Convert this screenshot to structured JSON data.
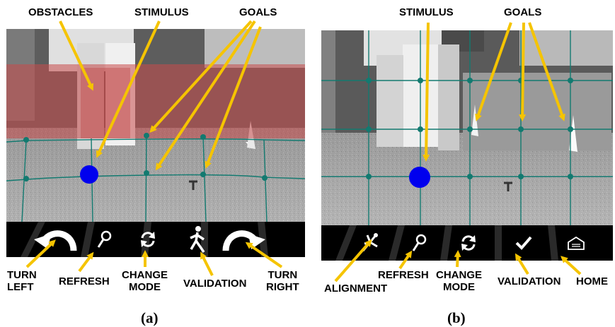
{
  "panel_a": {
    "caption": "(a)",
    "top_labels": {
      "obstacles": "OBSTACLES",
      "stimulus": "STIMULUS",
      "goals": "GOALS"
    },
    "toolbar": [
      {
        "icon": "turn-left-icon",
        "label": "TURN LEFT",
        "line1": "TURN",
        "line2": "LEFT"
      },
      {
        "icon": "refresh-icon",
        "label": "REFRESH"
      },
      {
        "icon": "change-mode-icon",
        "label": "CHANGE MODE",
        "line1": "CHANGE",
        "line2": "MODE"
      },
      {
        "icon": "validation-icon",
        "label": "VALIDATION"
      },
      {
        "icon": "turn-right-icon",
        "label": "TURN RIGHT",
        "line1": "TURN",
        "line2": "RIGHT"
      }
    ]
  },
  "panel_b": {
    "caption": "(b)",
    "top_labels": {
      "stimulus": "STIMULUS",
      "goals": "GOALS"
    },
    "toolbar": [
      {
        "icon": "alignment-icon",
        "label": "ALIGNMENT"
      },
      {
        "icon": "refresh-icon",
        "label": "REFRESH"
      },
      {
        "icon": "change-mode-icon",
        "label": "CHANGE MODE",
        "line1": "CHANGE",
        "line2": "MODE"
      },
      {
        "icon": "validation-icon",
        "label": "VALIDATION"
      },
      {
        "icon": "home-icon",
        "label": "HOME"
      }
    ]
  },
  "colors": {
    "obstacle": "#c84a4a",
    "grid": "#0f6b62",
    "stimulus": "#0000ee",
    "arrow": "#f5c400",
    "toolbar": "#000000"
  }
}
